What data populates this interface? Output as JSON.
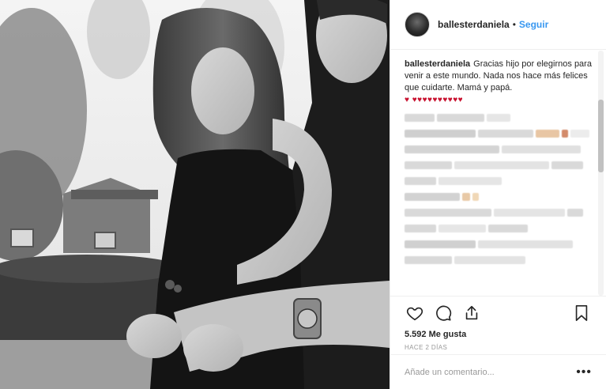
{
  "post": {
    "username": "ballesterdaniela",
    "separator": "•",
    "follow_label": "Seguir",
    "caption_text": "Gracias hijo por elegirnos para venir a este mundo. Nada nos hace más felices que cuidarte. Mamá y papá.",
    "caption_hearts": "♥ ♥♥♥♥♥♥♥♥♥♥",
    "likes_label": "5.592 Me gusta",
    "time_ago": "HACE 2 DÍAS",
    "comment_placeholder": "Añade un comentario...",
    "more_label": "•••"
  },
  "icons": {
    "like": "heart-icon",
    "comment": "comment-icon",
    "share": "share-icon",
    "save": "bookmark-icon",
    "avatar": "avatar"
  },
  "colors": {
    "link_blue": "#3897f0",
    "heart_red": "#c8102e",
    "muted_gray": "#999999",
    "text": "#262626",
    "divider": "#efefef"
  }
}
